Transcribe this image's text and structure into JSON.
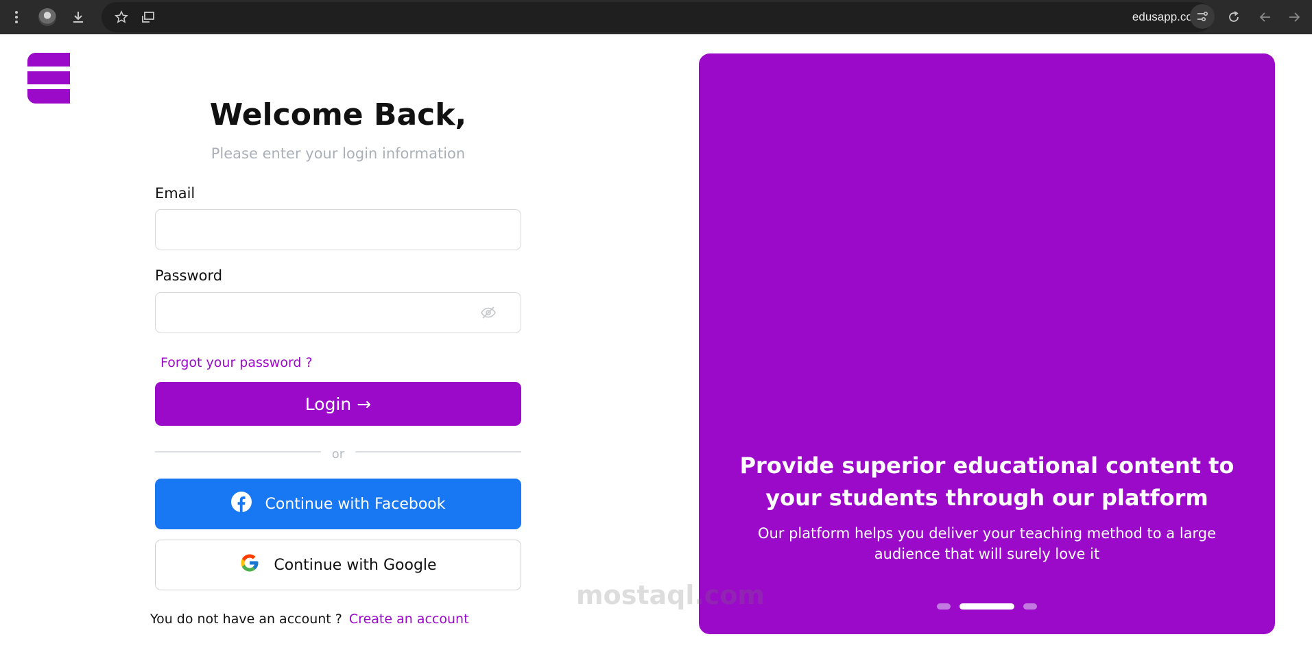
{
  "browser": {
    "url": "edusapp.com",
    "icons": [
      "menu-dots-icon",
      "profile-avatar-icon",
      "download-icon",
      "bookmark-star-icon",
      "send-to-device-icon",
      "tune-icon",
      "reload-icon",
      "back-arrow-icon",
      "forward-arrow-icon"
    ]
  },
  "form": {
    "title": "Welcome Back,",
    "subtitle": "Please enter your login information",
    "email_label": "Email",
    "email_value": "",
    "password_label": "Password",
    "password_value": "",
    "forgot_link": "Forgot your password ?",
    "login_label": "Login",
    "login_arrow": "→",
    "or_text": "or",
    "facebook_label": "Continue with Facebook",
    "google_label": "Continue with Google",
    "no_account_text": "You do not have an account ?",
    "create_account_link": "Create an account"
  },
  "panel": {
    "title": "Provide superior educational content to your students through our platform",
    "text": "Our platform helps you deliver your teaching method to a large audience that will surely love it",
    "carousel_active_index": 1,
    "carousel_count": 3
  },
  "watermark": {
    "text": "mostaql.com"
  },
  "colors": {
    "brand": "#9b09c9",
    "facebook": "#1877f2",
    "chrome_bg": "#2b2b2b"
  }
}
